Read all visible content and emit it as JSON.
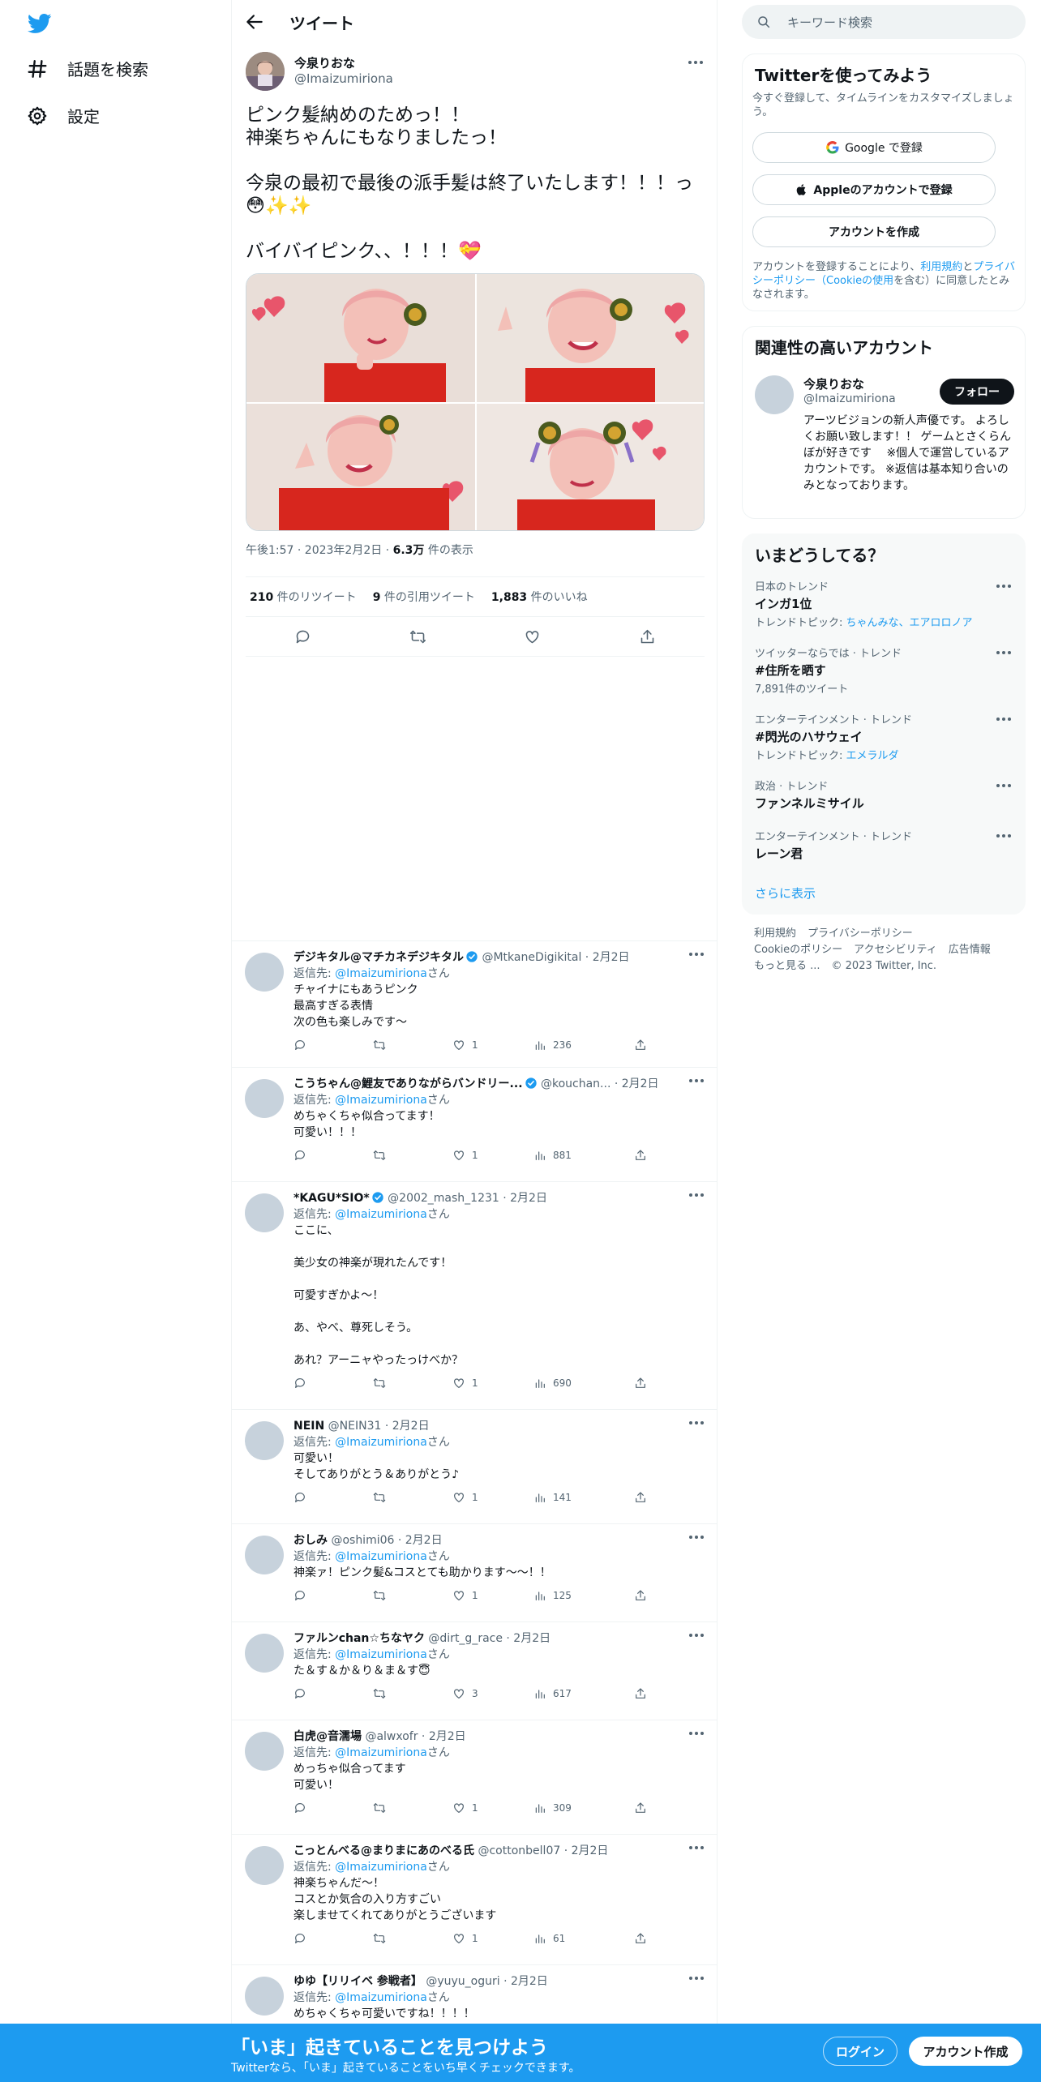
{
  "nav": {
    "explore_label": "話題を検索",
    "settings_label": "設定"
  },
  "header": {
    "title": "ツイート"
  },
  "tweet": {
    "author_name": "今泉りおな",
    "author_handle": "@Imaizumiriona",
    "text_line1": "ピンク髪納めのためっ！！",
    "text_line2": "神楽ちゃんにもなりましたっ！",
    "text_line3": "今泉の最初で最後の派手髪は終了いたします！！！っ",
    "text_line3_emoji": "😳✨✨",
    "text_line4": "バイバイピンク、、！！！💝",
    "time": "午後1:57 · 2023年2月2日 · ",
    "views_count": "6.3万",
    "views_label": " 件の表示",
    "retweets_count": "210",
    "retweets_label": " 件のリツイート",
    "quotes_count": "9",
    "quotes_label": " 件の引用ツイート",
    "likes_count": "1,883",
    "likes_label": " 件のいいね"
  },
  "replies": [
    {
      "name": "デジキタル@マチカネデジキタル",
      "verified": true,
      "handle": "@MtkaneDigikital · 2月2日",
      "to_prefix": "返信先: ",
      "to_handle": "@Imaizumiriona",
      "to_suffix": "さん",
      "text": "チャイナにもあうピンク\n最高すぎる表情\n次の色も楽しみです〜",
      "replies": "",
      "retweets": "",
      "likes": "1",
      "views": "236"
    },
    {
      "name": "こうちゃん@鯉友でありながらバンドリー...",
      "verified": true,
      "handle": "@kouchan... · 2月2日",
      "to_prefix": "返信先: ",
      "to_handle": "@Imaizumiriona",
      "to_suffix": "さん",
      "text": "めちゃくちゃ似合ってます！\n可愛い！！！",
      "replies": "",
      "retweets": "",
      "likes": "1",
      "views": "881"
    },
    {
      "name": "*KAGU*SIO*",
      "verified": true,
      "handle": "@2002_mash_1231 · 2月2日",
      "to_prefix": "返信先: ",
      "to_handle": "@Imaizumiriona",
      "to_suffix": "さん",
      "text": "ここに、\n\n美少女の神楽が現れたんです！\n\n可愛すぎかよ～！\n\nあ、やべ、尊死しそう。\n\nあれ？アーニャやったっけべか？",
      "replies": "",
      "retweets": "",
      "likes": "1",
      "views": "690"
    },
    {
      "name": "NEIN",
      "verified": false,
      "handle": "@NEIN31 · 2月2日",
      "to_prefix": "返信先: ",
      "to_handle": "@Imaizumiriona",
      "to_suffix": "さん",
      "text": "可愛い！\nそしてありがとう＆ありがとう♪",
      "replies": "",
      "retweets": "",
      "likes": "1",
      "views": "141"
    },
    {
      "name": "おしみ",
      "verified": false,
      "handle": "@oshimi06 · 2月2日",
      "to_prefix": "返信先: ",
      "to_handle": "@Imaizumiriona",
      "to_suffix": "さん",
      "text": "神楽ァ！ピンク髪&コスとても助かります～～！！",
      "replies": "",
      "retweets": "",
      "likes": "1",
      "views": "125"
    },
    {
      "name": "ファルンchan☆ちなヤク",
      "verified": false,
      "handle": "@dirt_g_race · 2月2日",
      "to_prefix": "返信先: ",
      "to_handle": "@Imaizumiriona",
      "to_suffix": "さん",
      "text": "た＆す＆か＆り＆ま＆す😇",
      "replies": "",
      "retweets": "",
      "likes": "3",
      "views": "617"
    },
    {
      "name": "白虎@音濡場",
      "verified": false,
      "handle": "@alwxofr · 2月2日",
      "to_prefix": "返信先: ",
      "to_handle": "@Imaizumiriona",
      "to_suffix": "さん",
      "text": "めっちゃ似合ってます\n可愛い！",
      "replies": "",
      "retweets": "",
      "likes": "1",
      "views": "309"
    },
    {
      "name": "こっとんべる@まりまにあのべる氏",
      "verified": false,
      "handle": "@cottonbell07 · 2月2日",
      "to_prefix": "返信先: ",
      "to_handle": "@Imaizumiriona",
      "to_suffix": "さん",
      "text": "神楽ちゃんだ～！\nコスとか気合の入り方すごい\n楽しませてくれてありがとうございます",
      "replies": "",
      "retweets": "",
      "likes": "1",
      "views": "61"
    },
    {
      "name": "ゆゆ【リリイベ 参戦者】",
      "verified": false,
      "handle": "@yuyu_oguri · 2月2日",
      "to_prefix": "返信先: ",
      "to_handle": "@Imaizumiriona",
      "to_suffix": "さん",
      "text": "めちゃくちゃ可愛いですね！！！！",
      "replies": "",
      "retweets": "",
      "likes": "",
      "views": ""
    }
  ],
  "search": {
    "placeholder": "キーワード検索"
  },
  "signup_card": {
    "title": "Twitterを使ってみよう",
    "desc": "今すぐ登録して、タイムラインをカスタマイズしましょう。",
    "google_label": "Google で登録",
    "apple_label": "Appleのアカウントで登録",
    "create_label": "アカウントを作成",
    "terms_prefix": "アカウントを登録することにより、",
    "terms_link1": "利用規約",
    "terms_and": "と",
    "terms_link2": "プライバシーポリシー",
    "terms_paren_open": "（",
    "terms_link3": "Cookieの使用",
    "terms_suffix": "を含む）に同意したとみなされます。"
  },
  "related_card": {
    "title": "関連性の高いアカウント",
    "name": "今泉りおな",
    "handle": "@Imaizumiriona",
    "follow_label": "フォロー",
    "bio": "アーツビジョンの新人声優です。 よろしくお願い致します！！ ゲームとさくらんぼが好きです　 ※個人で運営しているアカウントです。 ※返信は基本知り合いのみとなっております。"
  },
  "trends_card": {
    "title": "いまどうしてる？",
    "items": [
      {
        "category": "日本のトレンド",
        "title": "インガ1位",
        "sub_prefix": "トレンドトピック: ",
        "sub_links": "ちゃんみな、エアロロノア"
      },
      {
        "category": "ツイッターならでは · トレンド",
        "title": "#住所を晒す",
        "sub_prefix": "7,891件のツイート",
        "sub_links": ""
      },
      {
        "category": "エンターテインメント · トレンド",
        "title": "#閃光のハサウェイ",
        "sub_prefix": "トレンドトピック: ",
        "sub_links": "エメラルダ"
      },
      {
        "category": "政治 · トレンド",
        "title": "ファンネルミサイル",
        "sub_prefix": "",
        "sub_links": ""
      },
      {
        "category": "エンターテインメント · トレンド",
        "title": "レーン君",
        "sub_prefix": "",
        "sub_links": ""
      }
    ],
    "show_more": "さらに表示"
  },
  "footer": {
    "terms": "利用規約",
    "privacy": "プライバシーポリシー",
    "cookie": "Cookieのポリシー",
    "accessibility": "アクセシビリティ",
    "ads": "広告情報",
    "more": "もっと見る ...",
    "copyright": "© 2023 Twitter, Inc."
  },
  "bottom_bar": {
    "headline": "「いま」起きていることを見つけよう",
    "sub": "Twitterなら、「いま」起きていることをいち早くチェックできます。",
    "login_label": "ログイン",
    "signup_label": "アカウント作成"
  },
  "colors": {
    "accent": "#1d9bf0",
    "text": "#0f1419",
    "muted": "#536471",
    "border": "#eff3f4",
    "china_dress": "#d7261e"
  },
  "icons": [
    "twitter-bird-icon",
    "hashtag-icon",
    "gear-icon",
    "back-arrow-icon",
    "search-icon",
    "reply-icon",
    "retweet-icon",
    "like-icon",
    "share-icon",
    "views-icon",
    "verified-icon",
    "more-icon",
    "google-icon",
    "apple-icon"
  ]
}
